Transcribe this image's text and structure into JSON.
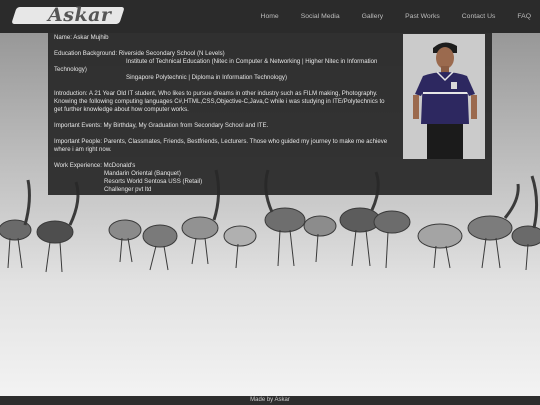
{
  "header": {
    "logo_text": "Askar",
    "nav": [
      "Home",
      "Social Media",
      "Gallery",
      "Past Works",
      "Contact Us",
      "FAQ"
    ]
  },
  "profile": {
    "name_line": "Name: Askar Mujhib",
    "education": {
      "label_line": "Education Background: Riverside Secondary School (N Levels)",
      "line2": "Institute of Technical Education (Nitec in Computer & Networking | Higher Nitec in Information",
      "line3": "Technology)",
      "line4": "Singapore Polytechnic | Diploma in Information Technology)"
    },
    "introduction": "Introduction: A 21 Year Old IT student, Who likes to pursue dreams in other industry such as FILM making, Photography. Knowing the following computing languages C#,HTML,CSS,Objective-C,Java,C while i was studying in ITE/Polytechnics to get further knowledge about how computer works.",
    "events": "Important Events: My Birthday, My Graduation from Secondary School and ITE.",
    "people": "Important People: Parents, Classmates, Friends, Bestfriends, Lecturers. Those who guided my journey to make me achieve where i am right now.",
    "work": {
      "label_line": "Work Experience: McDonald's",
      "items": [
        "Mandarin Oriental (Banquet)",
        "Resorts World Sentosa USS (Retail)",
        "Challenger pvt ltd"
      ]
    }
  },
  "footer": {
    "text": "Made by Askar"
  },
  "colors": {
    "navbar": "#2b2b2b",
    "panel": "#282828",
    "footer": "#2d2d2d"
  }
}
